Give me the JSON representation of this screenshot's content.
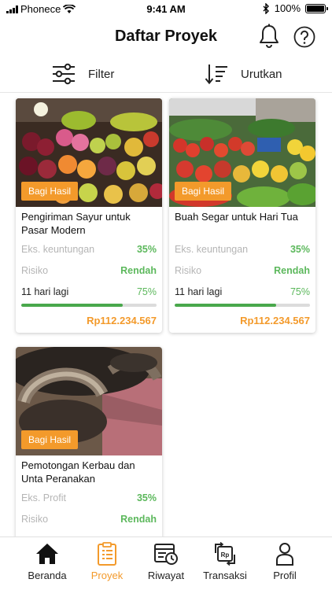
{
  "status_bar": {
    "carrier": "Phonece",
    "time": "9:41 AM",
    "battery": "100%"
  },
  "header": {
    "title": "Daftar Proyek"
  },
  "toolbar": {
    "filter_label": "Filter",
    "sort_label": "Urutkan"
  },
  "projects": [
    {
      "badge": "Bagi Hasil",
      "title": "Pengiriman Sayur untuk Pasar Modern",
      "profit_label": "Eks. keuntungan",
      "profit_value": "35%",
      "risk_label": "Risiko",
      "risk_value": "Rendah",
      "days_left": "11 hari lagi",
      "progress_text": "75%",
      "progress": 0.75,
      "amount": "Rp112.234.567"
    },
    {
      "badge": "Bagi Hasil",
      "title": "Buah Segar untuk Hari Tua",
      "profit_label": "Eks. keuntungan",
      "profit_value": "35%",
      "risk_label": "Risiko",
      "risk_value": "Rendah",
      "days_left": "11 hari lagi",
      "progress_text": "75%",
      "progress": 0.75,
      "amount": "Rp112.234.567"
    },
    {
      "badge": "Bagi Hasil",
      "title": "Pemotongan Kerbau dan Unta Peranakan",
      "profit_label": "Eks. Profit",
      "profit_value": "35%",
      "risk_label": "Risiko",
      "risk_value": "Rendah"
    }
  ],
  "bottom_nav": [
    {
      "label": "Beranda",
      "icon": "home-icon",
      "active": false
    },
    {
      "label": "Proyek",
      "icon": "project-list-icon",
      "active": true
    },
    {
      "label": "Riwayat",
      "icon": "history-icon",
      "active": false
    },
    {
      "label": "Transaksi",
      "icon": "transaction-icon",
      "active": false
    },
    {
      "label": "Profil",
      "icon": "profile-icon",
      "active": false
    }
  ],
  "colors": {
    "accent": "#f39a2b",
    "positive": "#5cb85c",
    "progress_fill": "#49a84c"
  }
}
